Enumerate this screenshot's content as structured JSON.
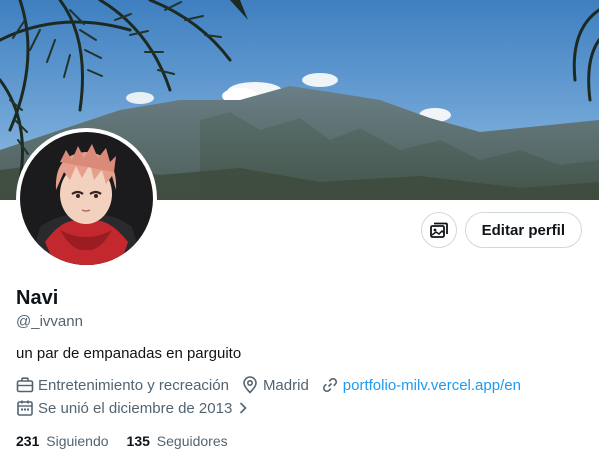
{
  "profile": {
    "name": "Navi",
    "handle": "@_ivvann",
    "bio": "un par de empanadas en parguito",
    "category": "Entretenimiento y recreación",
    "location": "Madrid",
    "website": "portfolio-milv.vercel.app/en",
    "joined": "Se unió el diciembre de 2013",
    "following_count": "231",
    "following_label": "Siguiendo",
    "followers_count": "135",
    "followers_label": "Seguidores"
  },
  "actions": {
    "media_icon": "image-switch-icon",
    "edit_label": "Editar perfil"
  },
  "icons": {
    "category": "briefcase-icon",
    "location": "location-pin-icon",
    "website": "link-icon",
    "joined": "calendar-icon",
    "joined_more": "chevron-right-icon"
  },
  "colors": {
    "text": "#0f1419",
    "secondary": "#536471",
    "link": "#1d9bf0",
    "border": "#cfd9de"
  }
}
